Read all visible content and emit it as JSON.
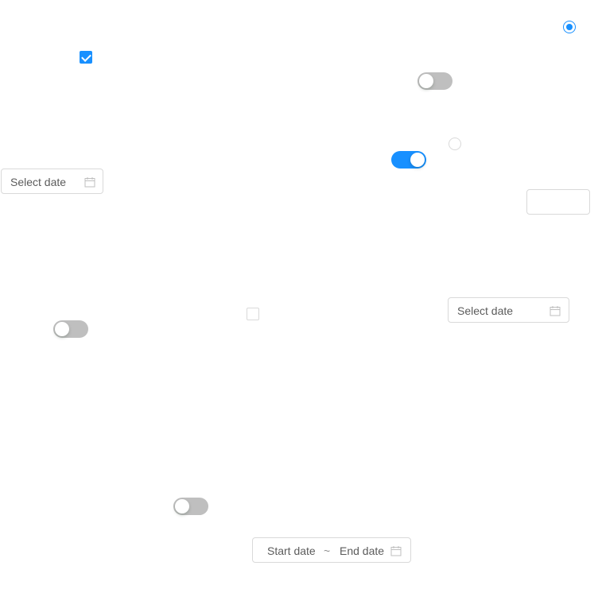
{
  "radios": [
    {
      "id": "radio-1",
      "checked": true
    },
    {
      "id": "radio-2",
      "checked": false
    }
  ],
  "checkboxes": [
    {
      "id": "checkbox-1",
      "checked": true
    },
    {
      "id": "checkbox-2",
      "checked": false
    }
  ],
  "switches": [
    {
      "id": "switch-1",
      "on": false
    },
    {
      "id": "switch-2",
      "on": true
    },
    {
      "id": "switch-3",
      "on": false
    },
    {
      "id": "switch-4",
      "on": false
    }
  ],
  "date_pickers": [
    {
      "id": "date-picker-1",
      "placeholder": "Select date",
      "icon": "calendar-icon"
    },
    {
      "id": "date-picker-2",
      "placeholder": "Select date",
      "icon": "calendar-icon"
    }
  ],
  "range_picker": {
    "start_placeholder": "Start date",
    "separator": "~",
    "end_placeholder": "End date",
    "icon": "calendar-icon"
  },
  "text_input": {
    "value": "",
    "placeholder": ""
  },
  "colors": {
    "primary": "#1890ff",
    "switch_off": "#bfbfbf",
    "border": "#d9d9d9",
    "text": "rgba(0,0,0,0.65)"
  }
}
